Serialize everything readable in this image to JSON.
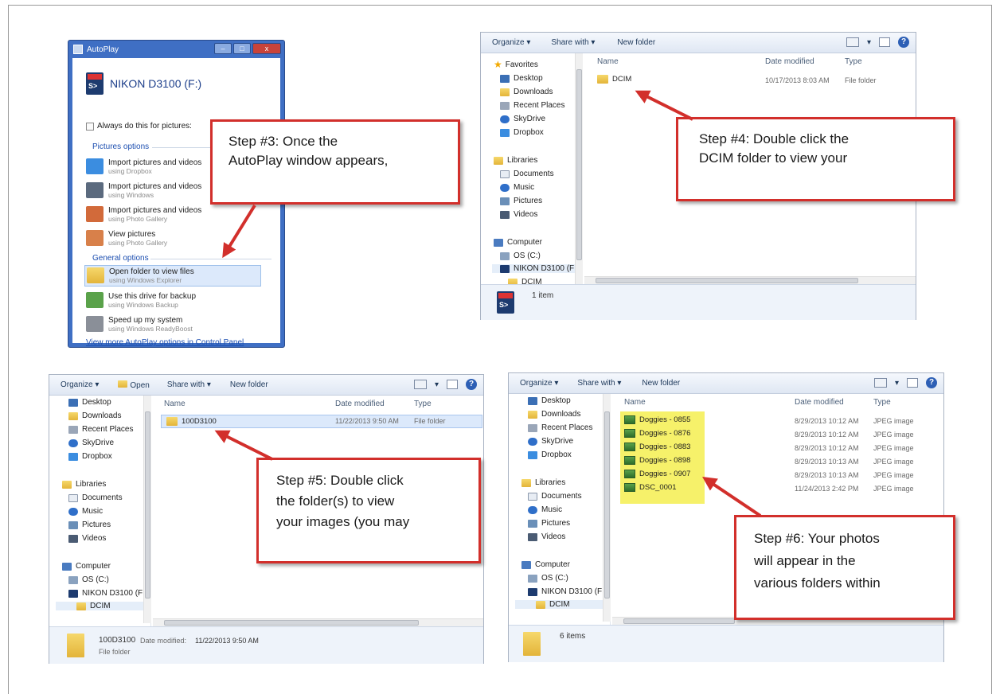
{
  "autoplay": {
    "title": "AutoPlay",
    "device": "NIKON D3100 (F:)",
    "always_label": "Always do this for pictures:",
    "pictures_options": "Pictures options",
    "general_options": "General options",
    "items": [
      {
        "title": "Import pictures and videos",
        "sub": "using Dropbox"
      },
      {
        "title": "Import pictures and videos",
        "sub": "using Windows"
      },
      {
        "title": "Import pictures and videos",
        "sub": "using Photo Gallery"
      },
      {
        "title": "View pictures",
        "sub": "using Photo Gallery"
      }
    ],
    "general_items": [
      {
        "title": "Open folder to view files",
        "sub": "using Windows Explorer"
      },
      {
        "title": "Use this drive for backup",
        "sub": "using Windows Backup"
      },
      {
        "title": "Speed up my system",
        "sub": "using Windows ReadyBoost"
      }
    ],
    "link": "View more AutoPlay options in Control Panel"
  },
  "toolbar": {
    "organize": "Organize ▾",
    "open": "Open",
    "share": "Share with ▾",
    "new_folder": "New folder",
    "view_menu": "▾",
    "help": "?"
  },
  "columns": {
    "name": "Name",
    "date": "Date modified",
    "type": "Type"
  },
  "win4": {
    "nav": [
      "Favorites",
      "Desktop",
      "Downloads",
      "Recent Places",
      "SkyDrive",
      "Dropbox",
      "Libraries",
      "Documents",
      "Music",
      "Pictures",
      "Videos",
      "Computer",
      "OS (C:)",
      "NIKON D3100 (F:",
      "DCIM"
    ],
    "file": {
      "name": "DCIM",
      "date": "10/17/2013 8:03 AM",
      "type": "File folder"
    },
    "status": "1 item"
  },
  "win5": {
    "nav": [
      "Desktop",
      "Downloads",
      "Recent Places",
      "SkyDrive",
      "Dropbox",
      "Libraries",
      "Documents",
      "Music",
      "Pictures",
      "Videos",
      "Computer",
      "OS (C:)",
      "NIKON D3100 (F:",
      "DCIM"
    ],
    "file": {
      "name": "100D3100",
      "date": "11/22/2013 9:50 AM",
      "type": "File folder"
    },
    "status_name": "100D3100",
    "status_date_label": "Date modified:",
    "status_date": "11/22/2013 9:50 AM",
    "status_type": "File folder"
  },
  "win6": {
    "nav": [
      "Desktop",
      "Downloads",
      "Recent Places",
      "SkyDrive",
      "Dropbox",
      "Libraries",
      "Documents",
      "Music",
      "Pictures",
      "Videos",
      "Computer",
      "OS (C:)",
      "NIKON D3100 (F:",
      "DCIM"
    ],
    "files": [
      {
        "name": "Doggies - 0855",
        "date": "8/29/2013 10:12 AM",
        "type": "JPEG image"
      },
      {
        "name": "Doggies - 0876",
        "date": "8/29/2013 10:12 AM",
        "type": "JPEG image"
      },
      {
        "name": "Doggies - 0883",
        "date": "8/29/2013 10:12 AM",
        "type": "JPEG image"
      },
      {
        "name": "Doggies - 0898",
        "date": "8/29/2013 10:13 AM",
        "type": "JPEG image"
      },
      {
        "name": "Doggies - 0907",
        "date": "8/29/2013 10:13 AM",
        "type": "JPEG image"
      },
      {
        "name": "DSC_0001",
        "date": "11/24/2013 2:42 PM",
        "type": "JPEG image"
      }
    ],
    "status": "6 items"
  },
  "callouts": {
    "step3": [
      "Step #3: Once the",
      "AutoPlay window appears,"
    ],
    "step4": [
      "Step #4: Double click the",
      "DCIM folder to view your"
    ],
    "step5": [
      "Step #5: Double click",
      "the folder(s) to view",
      "your images (you may"
    ],
    "step6": [
      "Step #6: Your photos",
      "will appear in the",
      "various folders within"
    ]
  },
  "colors": {
    "callout_border": "#d22f2b",
    "highlight": "#f6f16a",
    "autoplay_frame": "#3f6fc4"
  }
}
